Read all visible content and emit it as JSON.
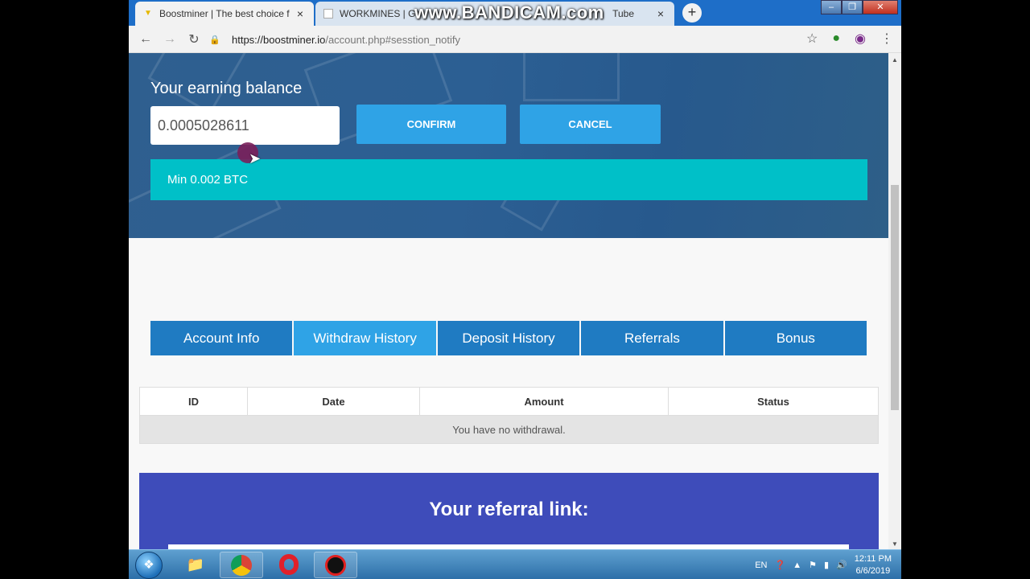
{
  "browser": {
    "tabs": [
      {
        "title": "Boostminer | The best choice for",
        "active": true
      },
      {
        "title": "WORKMINES | Ge",
        "active": false
      },
      {
        "title": "Tube",
        "active": false
      }
    ],
    "watermark": "www.BANDICAM.com",
    "url_host": "https://boostminer.io",
    "url_path": "/account.php#sesstion_notify"
  },
  "withdraw_form": {
    "label": "Your earning balance",
    "balance_value": "0.0005028611",
    "confirm_label": "CONFIRM",
    "cancel_label": "CANCEL",
    "min_notice": "Min 0.002 BTC"
  },
  "account_tabs": [
    {
      "label": "Account Info"
    },
    {
      "label": "Withdraw History"
    },
    {
      "label": "Deposit History"
    },
    {
      "label": "Referrals"
    },
    {
      "label": "Bonus"
    }
  ],
  "withdraw_table": {
    "headers": {
      "id": "ID",
      "date": "Date",
      "amount": "Amount",
      "status": "Status"
    },
    "empty_message": "You have no withdrawal."
  },
  "referral": {
    "title": "Your referral link:"
  },
  "taskbar": {
    "language": "EN",
    "time": "12:11 PM",
    "date": "6/6/2019"
  },
  "colors": {
    "hero_bg": "#2c5f93",
    "button_blue": "#2fa3e6",
    "notice_teal": "#00c0c8",
    "tab_blue": "#1f7bc2",
    "referral_bg": "#3e4cba"
  }
}
